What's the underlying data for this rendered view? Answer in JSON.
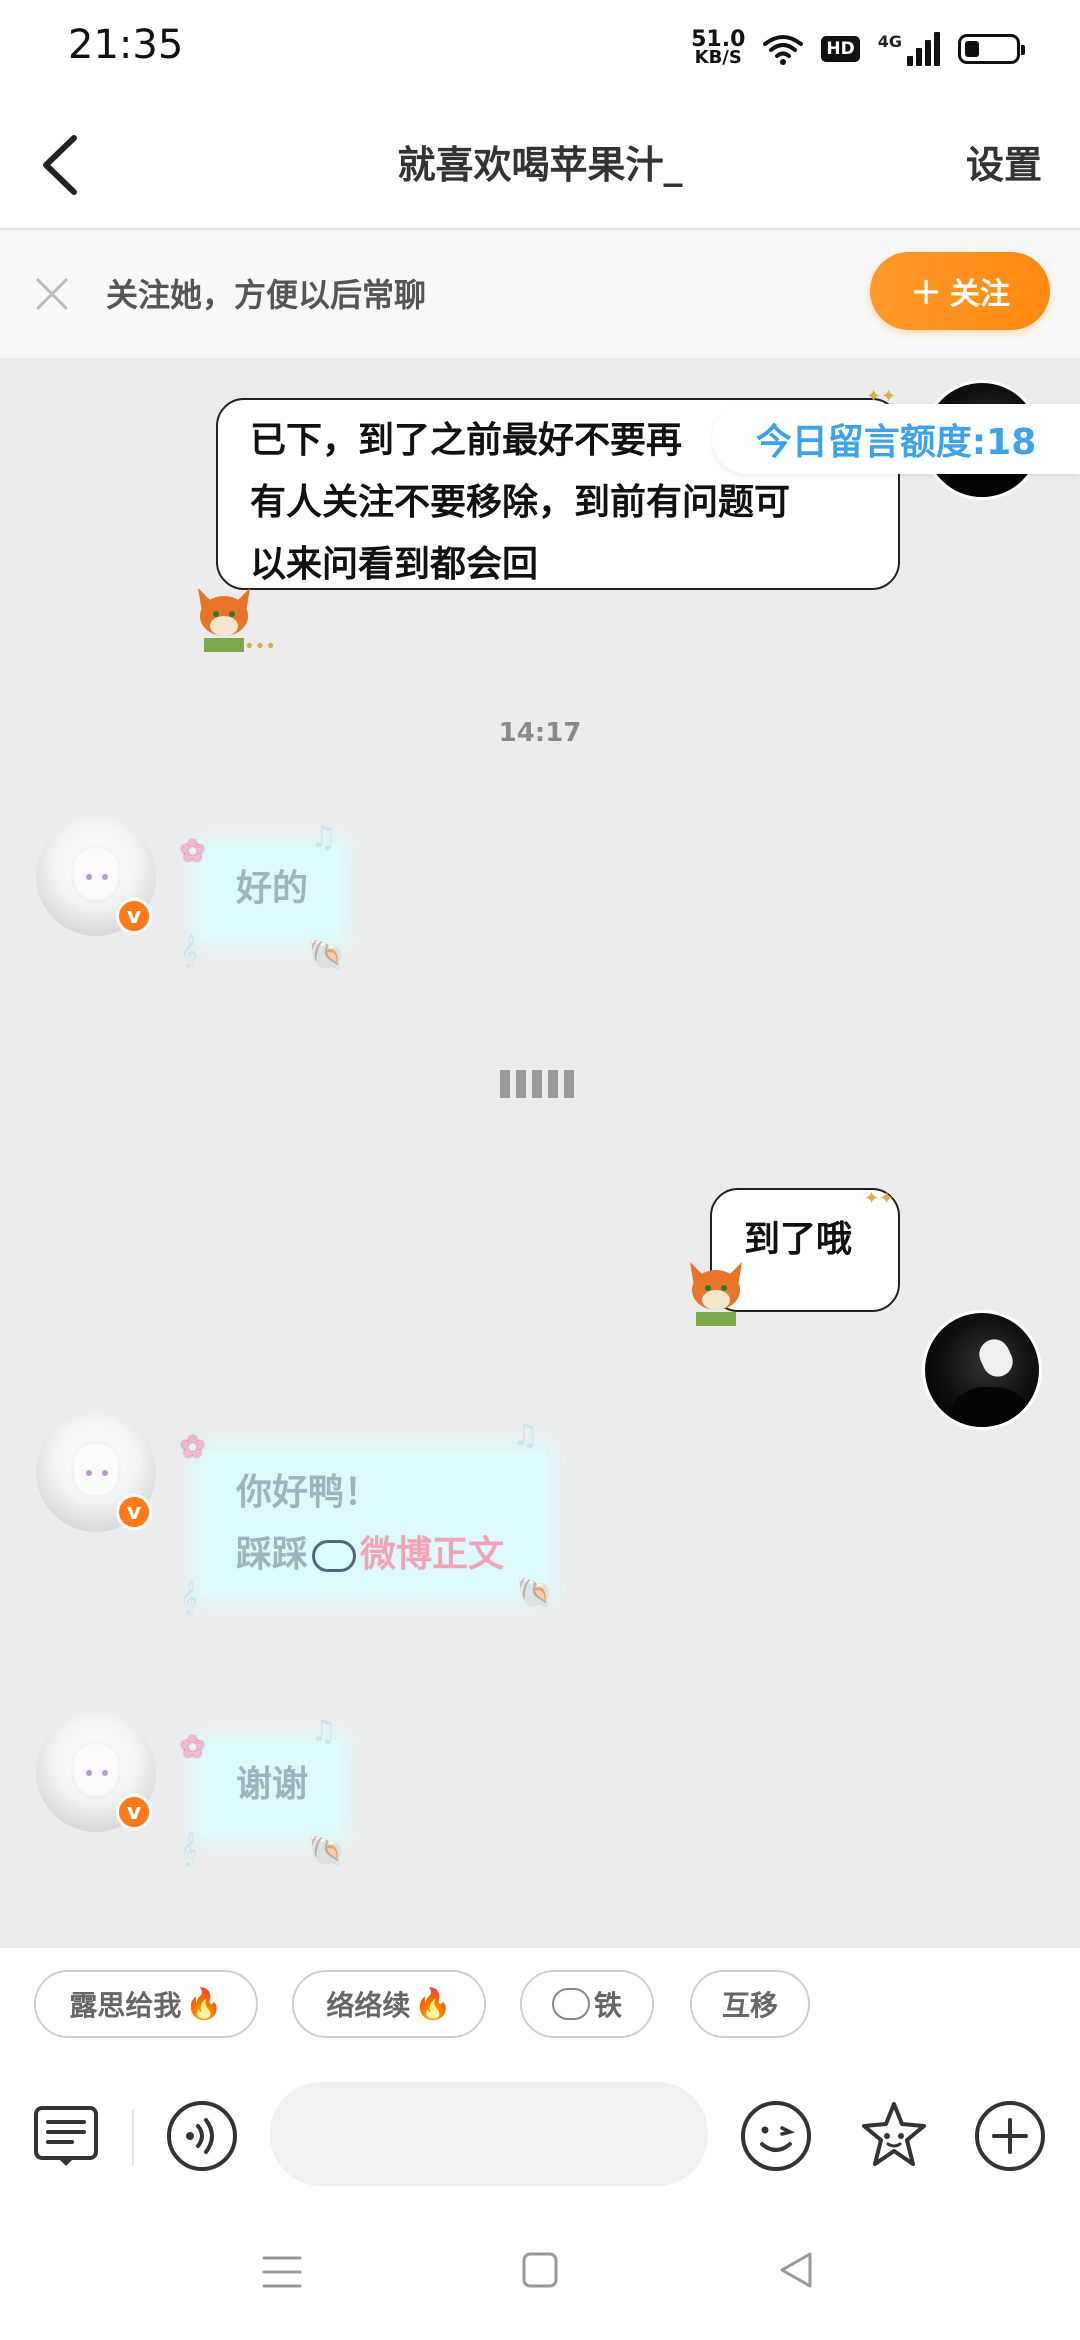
{
  "status_bar": {
    "time": "21:35",
    "net_speed_value": "51.0",
    "net_speed_unit": "KB/S",
    "hd_badge": "HD",
    "network_type": "4G",
    "battery_level_percent": 25
  },
  "header": {
    "title": "就喜欢喝苹果汁_",
    "settings_label": "设置"
  },
  "follow_banner": {
    "text": "关注她，方便以后常聊",
    "button_label": "关注",
    "button_plus": "+"
  },
  "quota": {
    "label": "今日留言额度:18"
  },
  "messages": [
    {
      "side": "right",
      "lines": [
        "已下，到了之前最好不要再",
        "有人关注不要移除，到前有问题可",
        "以来问看到都会回"
      ]
    },
    {
      "type": "timestamp",
      "text": "14:17"
    },
    {
      "side": "left",
      "lines": [
        "好的"
      ]
    },
    {
      "side": "right",
      "lines": [
        "到了哦"
      ]
    },
    {
      "side": "left",
      "lines": [
        "你好鸭！",
        "踩踩"
      ],
      "link_text": "微博正文"
    },
    {
      "side": "left",
      "lines": [
        "谢谢"
      ]
    }
  ],
  "verified_mark": "v",
  "quick_replies": [
    {
      "label": "露思给我",
      "emoji": "🔥"
    },
    {
      "label": "络络续",
      "emoji": "🔥"
    },
    {
      "label": "铁",
      "emoji": "sheep"
    },
    {
      "label": "互移",
      "emoji": ""
    }
  ],
  "input_bar": {
    "placeholder": ""
  },
  "icons": [
    "back-icon",
    "close-icon",
    "menu-icon",
    "voice-icon",
    "emoji-icon",
    "sticker-icon",
    "plus-icon",
    "home-icon",
    "recent-apps-icon",
    "system-back-icon"
  ]
}
